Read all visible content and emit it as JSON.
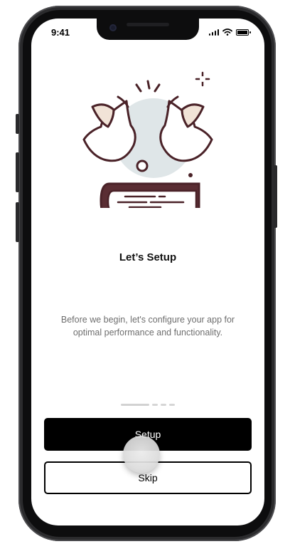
{
  "status_bar": {
    "time": "9:41"
  },
  "onboarding": {
    "title": "Let’s Setup",
    "description": "Before we begin, let's configure your app for optimal performance and functionality.",
    "page_count": 4,
    "active_page": 1
  },
  "actions": {
    "primary_label": "Setup",
    "secondary_label": "Skip"
  },
  "colors": {
    "primary_button": "#000000",
    "illustration_outline": "#4a2228",
    "illustration_bg": "#dfe6e8",
    "bird_accent": "#f1e3d7"
  },
  "icons": [
    "signal-icon",
    "wifi-icon",
    "battery-icon",
    "birds-book-illustration"
  ]
}
